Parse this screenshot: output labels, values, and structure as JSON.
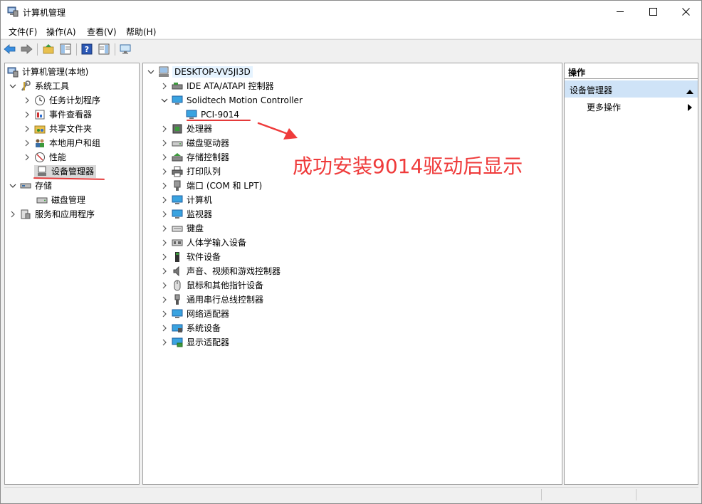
{
  "window": {
    "title": "计算机管理"
  },
  "menu": [
    "文件(F)",
    "操作(A)",
    "查看(V)",
    "帮助(H)"
  ],
  "left_tree": {
    "root": "计算机管理(本地)",
    "system_tools": "系统工具",
    "task_scheduler": "任务计划程序",
    "event_viewer": "事件查看器",
    "shared_folders": "共享文件夹",
    "local_users": "本地用户和组",
    "performance": "性能",
    "device_manager": "设备管理器",
    "storage": "存储",
    "disk_management": "磁盘管理",
    "services_apps": "服务和应用程序"
  },
  "device_tree": {
    "computer": "DESKTOP-VV5JI3D",
    "ide": "IDE ATA/ATAPI 控制器",
    "solidtech": "Solidtech Motion Controller",
    "pci9014": "PCI-9014",
    "processor": "处理器",
    "disk_drives": "磁盘驱动器",
    "storage_ctrl": "存储控制器",
    "print_queue": "打印队列",
    "ports": "端口 (COM 和 LPT)",
    "computer_node": "计算机",
    "monitors": "监视器",
    "keyboard": "键盘",
    "hid": "人体学输入设备",
    "software_dev": "软件设备",
    "sound": "声音、视频和游戏控制器",
    "mice": "鼠标和其他指针设备",
    "usb": "通用串行总线控制器",
    "network": "网络适配器",
    "system_dev": "系统设备",
    "display": "显示适配器"
  },
  "actions": {
    "header": "操作",
    "section": "设备管理器",
    "more": "更多操作"
  },
  "annotation": {
    "text": "成功安装9014驱动后显示",
    "color": "#ef3b3b"
  }
}
